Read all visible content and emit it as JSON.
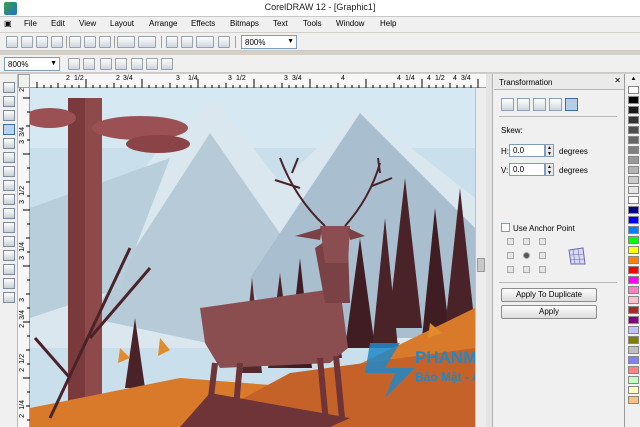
{
  "window": {
    "title": "CorelDRAW 12 - [Graphic1]"
  },
  "menu": {
    "items": [
      {
        "label": "File",
        "name": "menu-file"
      },
      {
        "label": "Edit",
        "name": "menu-edit"
      },
      {
        "label": "View",
        "name": "menu-view"
      },
      {
        "label": "Layout",
        "name": "menu-layout"
      },
      {
        "label": "Arrange",
        "name": "menu-arrange"
      },
      {
        "label": "Effects",
        "name": "menu-effects"
      },
      {
        "label": "Bitmaps",
        "name": "menu-bitmaps"
      },
      {
        "label": "Text",
        "name": "menu-text"
      },
      {
        "label": "Tools",
        "name": "menu-tools"
      },
      {
        "label": "Window",
        "name": "menu-window"
      },
      {
        "label": "Help",
        "name": "menu-help"
      }
    ]
  },
  "toolbar": {
    "zoom_level": "800%"
  },
  "zoombar": {
    "zoom_level": "800%"
  },
  "rulers": {
    "horizontal": [
      "2",
      "1/2",
      "2",
      "3/4",
      "3",
      "1/4",
      "3",
      "1/2",
      "3",
      "3/4",
      "4",
      "4",
      "1/4",
      "4",
      "1/2",
      "4",
      "3/4"
    ],
    "vertical": [
      "3",
      "3/4",
      "3",
      "1/2",
      "3",
      "1/4",
      "3",
      "2",
      "3/4",
      "2",
      "1/2",
      "2",
      "1/4",
      "2"
    ]
  },
  "docker": {
    "title": "Transformation",
    "skew_label": "Skew:",
    "h_label": "H:",
    "h_value": "0.0",
    "v_label": "V:",
    "v_value": "0.0",
    "units": "degrees",
    "anchor_label": "Use Anchor Point",
    "apply_duplicate": "Apply To Duplicate",
    "apply": "Apply"
  },
  "palette": {
    "colors": [
      "#ffffff",
      "#000000",
      "#1a1a1a",
      "#333333",
      "#4d4d4d",
      "#666666",
      "#808080",
      "#999999",
      "#b3b3b3",
      "#cccccc",
      "#e6e6e6",
      "#ffffff",
      "#00008b",
      "#0000ff",
      "#0080ff",
      "#00ff00",
      "#ffff00",
      "#ff8000",
      "#ff0000",
      "#ff00ff",
      "#ff80c0",
      "#ffc0cb",
      "#a52a2a",
      "#800080",
      "#c0c0ff",
      "#808000",
      "#c0c0c0",
      "#8080ff",
      "#ff8080",
      "#c0ffc0",
      "#ffffc0",
      "#ffc080"
    ]
  },
  "watermark": {
    "line1": "PHANMEMMAYTINH.VN",
    "line2": "Bảo Mật - An Toàn - Tiện Lợi"
  },
  "colors": {
    "sky": "#c9dfeb",
    "tree_dark": "#4a2328",
    "deer": "#8a4e50",
    "ground": "#d87a2a",
    "accent_blue": "#1e88c8"
  }
}
